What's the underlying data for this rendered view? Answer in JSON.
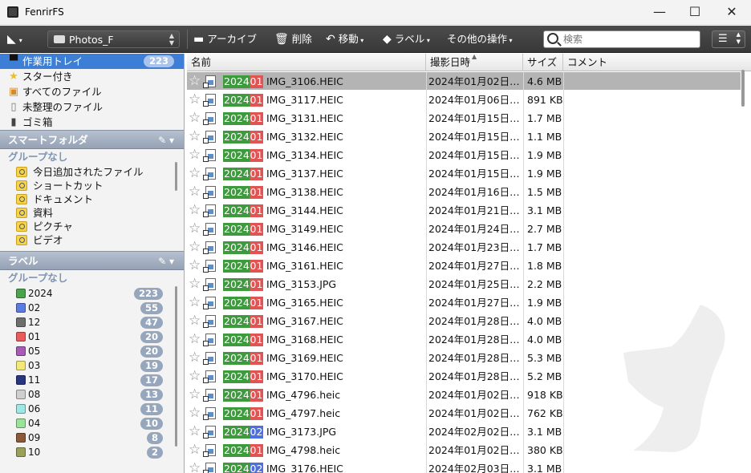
{
  "window": {
    "title": "FenrirFS",
    "minimize": "—",
    "maximize": "☐",
    "close": "✕"
  },
  "toolbar": {
    "vault_name": "Photos_F",
    "archive": "アーカイブ",
    "delete": "削除",
    "move": "移動",
    "label": "ラベル",
    "other": "その他の操作",
    "search_placeholder": "検索"
  },
  "sidebar": {
    "nav": [
      {
        "label": "作業用トレイ",
        "count": "223",
        "icon": "tray-icon"
      },
      {
        "label": "スター付き",
        "count": "",
        "icon": "star-icon"
      },
      {
        "label": "すべてのファイル",
        "count": "",
        "icon": "box-icon"
      },
      {
        "label": "未整理のファイル",
        "count": "",
        "icon": "document-icon"
      },
      {
        "label": "ゴミ箱",
        "count": "",
        "icon": "trash-icon"
      }
    ],
    "smart_folder_header": "スマートフォルダ",
    "smart_group": "グループなし",
    "smart_folders": [
      "今日追加されたファイル",
      "ショートカット",
      "ドキュメント",
      "資料",
      "ピクチャ",
      "ビデオ"
    ],
    "label_header": "ラベル",
    "label_group": "グループなし",
    "labels": [
      {
        "name": "2024",
        "count": "223",
        "color": "#4aa34a"
      },
      {
        "name": "02",
        "count": "55",
        "color": "#5b7be0"
      },
      {
        "name": "12",
        "count": "47",
        "color": "#6e6e6e"
      },
      {
        "name": "01",
        "count": "20",
        "color": "#ea5b5b"
      },
      {
        "name": "05",
        "count": "20",
        "color": "#a75bb5"
      },
      {
        "name": "03",
        "count": "19",
        "color": "#f3e879"
      },
      {
        "name": "11",
        "count": "17",
        "color": "#2a3580"
      },
      {
        "name": "08",
        "count": "13",
        "color": "#cfcfcf"
      },
      {
        "name": "06",
        "count": "11",
        "color": "#9fe6e6"
      },
      {
        "name": "04",
        "count": "10",
        "color": "#9be39b"
      },
      {
        "name": "09",
        "count": "8",
        "color": "#8a5a3a"
      },
      {
        "name": "10",
        "count": "2",
        "color": "#9aa05a"
      }
    ]
  },
  "columns": {
    "name": "名前",
    "date": "撮影日時",
    "size": "サイズ",
    "comment": "コメント"
  },
  "files": [
    {
      "tag1": "2024",
      "tag2": "01",
      "tag2_color": "#e05454",
      "name": "IMG_3106.HEIC",
      "date": "2024年01月02日…",
      "size": "4.6 MB"
    },
    {
      "tag1": "2024",
      "tag2": "01",
      "tag2_color": "#e05454",
      "name": "IMG_3117.HEIC",
      "date": "2024年01月06日…",
      "size": "891 KB"
    },
    {
      "tag1": "2024",
      "tag2": "01",
      "tag2_color": "#e05454",
      "name": "IMG_3131.HEIC",
      "date": "2024年01月15日…",
      "size": "1.7 MB"
    },
    {
      "tag1": "2024",
      "tag2": "01",
      "tag2_color": "#e05454",
      "name": "IMG_3132.HEIC",
      "date": "2024年01月15日…",
      "size": "1.1 MB"
    },
    {
      "tag1": "2024",
      "tag2": "01",
      "tag2_color": "#e05454",
      "name": "IMG_3134.HEIC",
      "date": "2024年01月15日…",
      "size": "1.9 MB"
    },
    {
      "tag1": "2024",
      "tag2": "01",
      "tag2_color": "#e05454",
      "name": "IMG_3137.HEIC",
      "date": "2024年01月15日…",
      "size": "1.9 MB"
    },
    {
      "tag1": "2024",
      "tag2": "01",
      "tag2_color": "#e05454",
      "name": "IMG_3138.HEIC",
      "date": "2024年01月16日…",
      "size": "1.5 MB"
    },
    {
      "tag1": "2024",
      "tag2": "01",
      "tag2_color": "#e05454",
      "name": "IMG_3144.HEIC",
      "date": "2024年01月21日…",
      "size": "3.1 MB"
    },
    {
      "tag1": "2024",
      "tag2": "01",
      "tag2_color": "#e05454",
      "name": "IMG_3149.HEIC",
      "date": "2024年01月24日…",
      "size": "2.7 MB"
    },
    {
      "tag1": "2024",
      "tag2": "01",
      "tag2_color": "#e05454",
      "name": "IMG_3146.HEIC",
      "date": "2024年01月23日…",
      "size": "1.7 MB"
    },
    {
      "tag1": "2024",
      "tag2": "01",
      "tag2_color": "#e05454",
      "name": "IMG_3161.HEIC",
      "date": "2024年01月27日…",
      "size": "1.8 MB"
    },
    {
      "tag1": "2024",
      "tag2": "01",
      "tag2_color": "#e05454",
      "name": "IMG_3153.JPG",
      "date": "2024年01月25日…",
      "size": "2.2 MB"
    },
    {
      "tag1": "2024",
      "tag2": "01",
      "tag2_color": "#e05454",
      "name": "IMG_3165.HEIC",
      "date": "2024年01月27日…",
      "size": "1.9 MB"
    },
    {
      "tag1": "2024",
      "tag2": "01",
      "tag2_color": "#e05454",
      "name": "IMG_3167.HEIC",
      "date": "2024年01月28日…",
      "size": "4.0 MB"
    },
    {
      "tag1": "2024",
      "tag2": "01",
      "tag2_color": "#e05454",
      "name": "IMG_3168.HEIC",
      "date": "2024年01月28日…",
      "size": "4.0 MB"
    },
    {
      "tag1": "2024",
      "tag2": "01",
      "tag2_color": "#e05454",
      "name": "IMG_3169.HEIC",
      "date": "2024年01月28日…",
      "size": "5.3 MB"
    },
    {
      "tag1": "2024",
      "tag2": "01",
      "tag2_color": "#e05454",
      "name": "IMG_3170.HEIC",
      "date": "2024年01月28日…",
      "size": "5.2 MB"
    },
    {
      "tag1": "2024",
      "tag2": "01",
      "tag2_color": "#e05454",
      "name": "IMG_4796.heic",
      "date": "2024年01月02日…",
      "size": "918 KB"
    },
    {
      "tag1": "2024",
      "tag2": "01",
      "tag2_color": "#e05454",
      "name": "IMG_4797.heic",
      "date": "2024年01月02日…",
      "size": "762 KB"
    },
    {
      "tag1": "2024",
      "tag2": "02",
      "tag2_color": "#4f6fe0",
      "name": "IMG_3173.JPG",
      "date": "2024年02月02日…",
      "size": "3.1 MB"
    },
    {
      "tag1": "2024",
      "tag2": "01",
      "tag2_color": "#e05454",
      "name": "IMG_4798.heic",
      "date": "2024年01月02日…",
      "size": "380 KB"
    },
    {
      "tag1": "2024",
      "tag2": "02",
      "tag2_color": "#4f6fe0",
      "name": "IMG_3176.HEIC",
      "date": "2024年02月03日…",
      "size": "3.1 MB"
    }
  ],
  "colors": {
    "accent": "#3d7fd6",
    "toolbar": "#404040",
    "tag_year": "#3d9a3d"
  }
}
